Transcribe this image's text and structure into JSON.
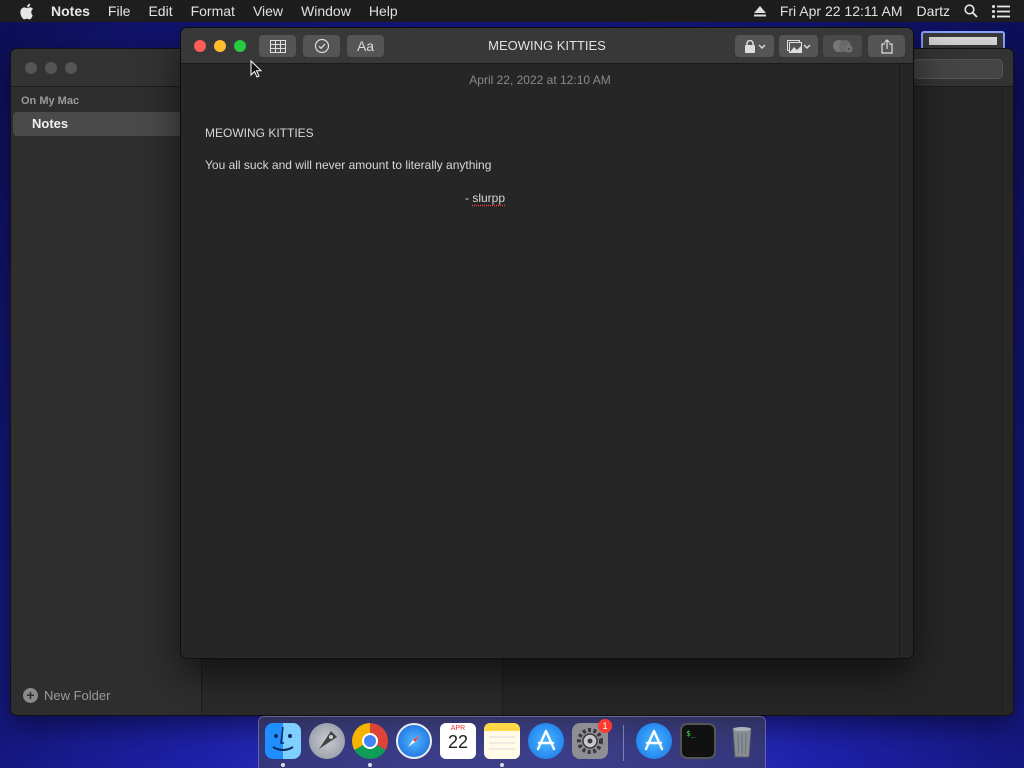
{
  "menubar": {
    "app_name": "Notes",
    "menus": [
      "File",
      "Edit",
      "Format",
      "View",
      "Window",
      "Help"
    ],
    "datetime": "Fri Apr 22  12:11 AM",
    "user": "Dartz"
  },
  "back_window": {
    "sidebar": {
      "section_header": "On My Mac",
      "selected_folder": "Notes",
      "new_folder_label": "New Folder"
    }
  },
  "note_window": {
    "title": "MEOWING KITTIES",
    "date": "April 22, 2022 at 12:10 AM",
    "body": {
      "heading": "MEOWING KITTIES",
      "line1": "You all suck and will never amount to literally anything",
      "sign_prefix": "- ",
      "sign_name": "slurpp"
    },
    "toolbar": {
      "font_button_label": "Aa"
    }
  },
  "dock": {
    "items": [
      "finder",
      "launchpad",
      "chrome",
      "safari",
      "calendar",
      "notes",
      "app-store",
      "system-preferences",
      "app-store-installer",
      "terminal",
      "trash"
    ],
    "calendar_month": "APR",
    "calendar_day": "22",
    "system_prefs_badge": "1",
    "terminal_prompt": "$_"
  },
  "colors": {
    "close": "#ff5f57",
    "minimize": "#febc2e",
    "zoom": "#28c840"
  }
}
